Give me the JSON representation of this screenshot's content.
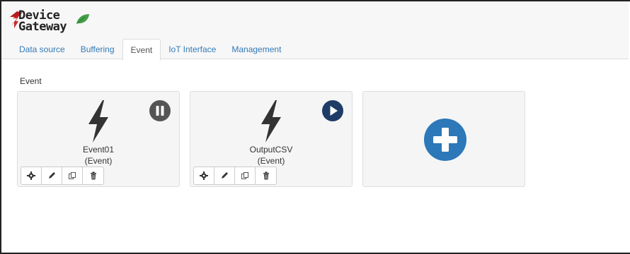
{
  "app": {
    "logo_line1": "Device",
    "logo_line2": "Gateway",
    "logo_colors": {
      "arrow": "#c62828",
      "leaf": "#43a047"
    }
  },
  "tabs": [
    {
      "label": "Data source",
      "active": false
    },
    {
      "label": "Buffering",
      "active": false
    },
    {
      "label": "Event",
      "active": true
    },
    {
      "label": "IoT Interface",
      "active": false
    },
    {
      "label": "Management",
      "active": false
    }
  ],
  "main": {
    "section_label": "Event",
    "cards": [
      {
        "name": "Event01",
        "type": "(Event)",
        "status_icon": "pause-icon",
        "status_color": "#555555"
      },
      {
        "name": "OutputCSV",
        "type": "(Event)",
        "status_icon": "play-icon",
        "status_color": "#1f3c66"
      }
    ],
    "card_actions": [
      "gear-icon",
      "pencil-icon",
      "copy-icon",
      "trash-icon"
    ],
    "add_card": {
      "icon": "plus-circle-icon",
      "color": "#2c78b8"
    }
  }
}
